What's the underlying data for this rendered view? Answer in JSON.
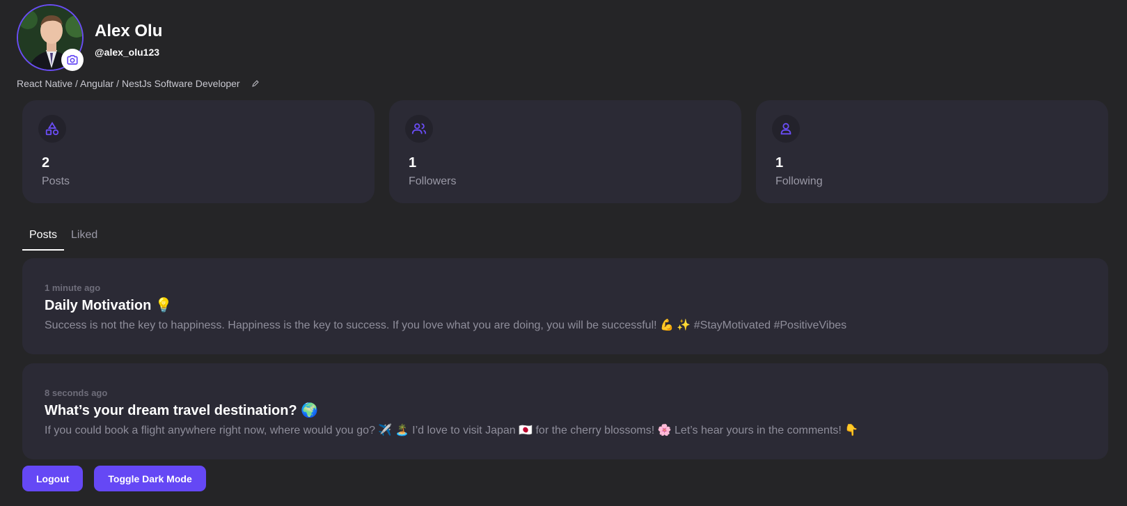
{
  "profile": {
    "name": "Alex Olu",
    "username": "@alex_olu123",
    "bio": "React Native / Angular / NestJs Software Developer"
  },
  "stats": [
    {
      "icon": "shapes-icon",
      "value": "2",
      "label": "Posts"
    },
    {
      "icon": "users-icon",
      "value": "1",
      "label": "Followers"
    },
    {
      "icon": "user-icon",
      "value": "1",
      "label": "Following"
    }
  ],
  "tabs": [
    {
      "label": "Posts",
      "active": true
    },
    {
      "label": "Liked",
      "active": false
    }
  ],
  "posts": [
    {
      "time": "1 minute ago",
      "title": "Daily Motivation 💡",
      "body": "Success is not the key to happiness. Happiness is the key to success. If you love what you are doing, you will be successful! 💪 ✨ #StayMotivated #PositiveVibes"
    },
    {
      "time": "8 seconds ago",
      "title": "What’s your dream travel destination? 🌍",
      "body": "If you could book a flight anywhere right now, where would you go? ✈️ 🏝️ I’d love to visit Japan 🇯🇵 for the cherry blossoms! 🌸 Let’s hear yours in the comments! 👇"
    }
  ],
  "actions": {
    "logout_label": "Logout",
    "toggle_label": "Toggle Dark Mode"
  },
  "colors": {
    "background": "#252527",
    "card": "#2b2a35",
    "accent": "#6548f5",
    "muted_text": "#9a99a6"
  }
}
